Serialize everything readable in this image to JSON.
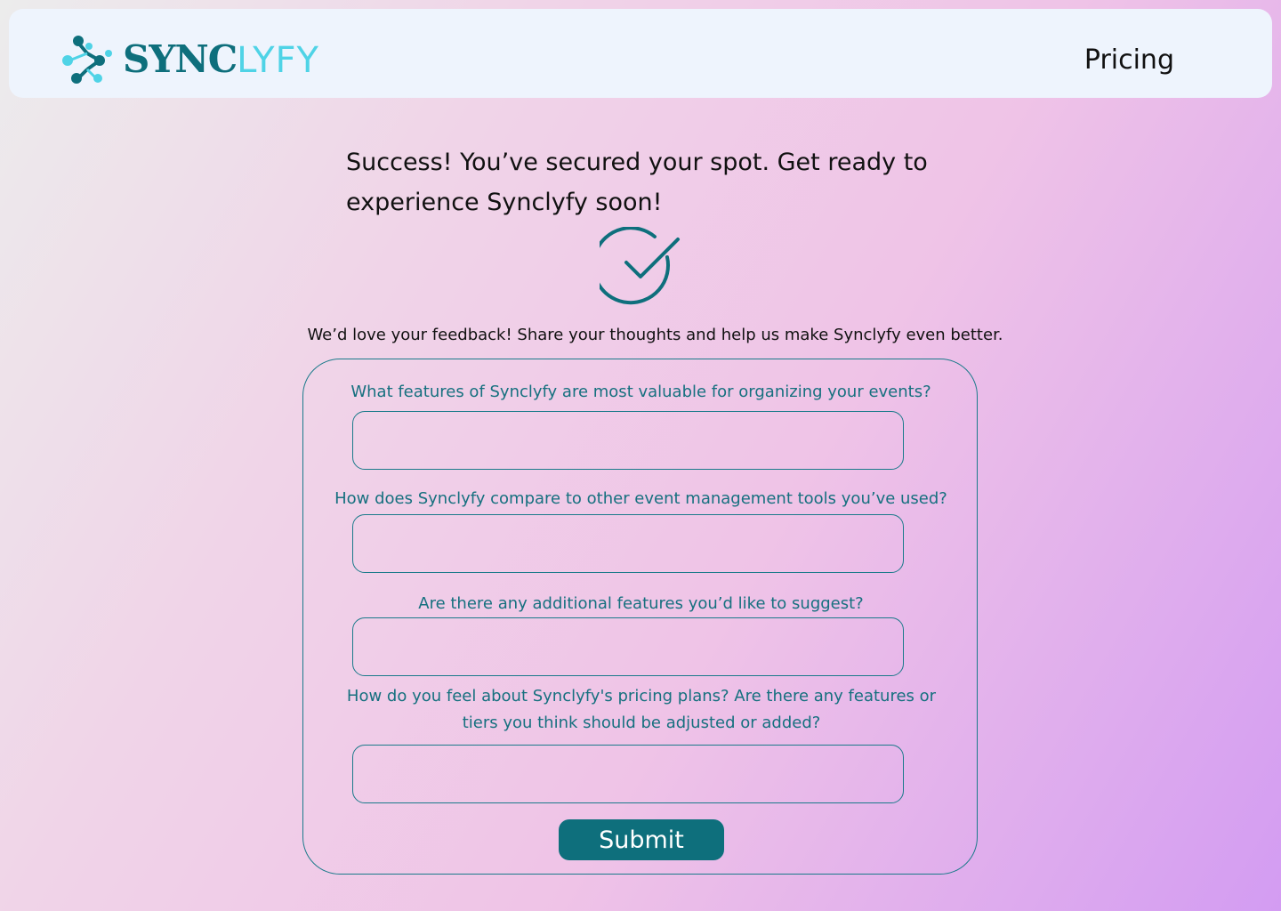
{
  "header": {
    "logo": {
      "icon": "molecule-nodes-icon",
      "text_primary": "SYNC",
      "text_accent": "LYFY"
    },
    "nav": {
      "pricing_label": "Pricing"
    }
  },
  "main": {
    "success_message": "Success! You’ve secured your spot. Get ready to experience Synclyfy soon!",
    "success_icon": "check-circle-icon",
    "feedback_intro": "We’d love your feedback! Share your thoughts and help us make Synclyfy even better.",
    "form": {
      "questions": [
        {
          "label": "What features of Synclyfy are most valuable for organizing your events?",
          "value": "",
          "placeholder": ""
        },
        {
          "label": "How does Synclyfy compare to other event management tools you’ve used?",
          "value": "",
          "placeholder": ""
        },
        {
          "label": "Are there any additional features you’d like to suggest?",
          "value": "",
          "placeholder": ""
        },
        {
          "label": "How do you feel about Synclyfy's pricing plans? Are there any features or tiers you think should be adjusted or added?",
          "value": "",
          "placeholder": ""
        }
      ],
      "submit_label": "Submit"
    }
  },
  "colors": {
    "brand_primary": "#0e6f7c",
    "brand_accent": "#4fd3e6",
    "header_bg": "#eef4fd",
    "label_color": "#16707f"
  }
}
